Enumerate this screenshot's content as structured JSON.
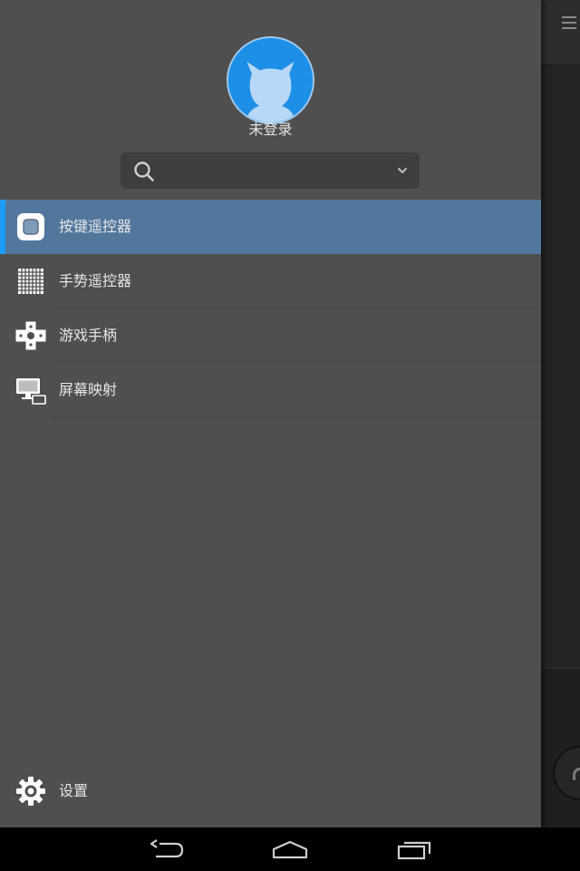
{
  "user": {
    "name": "未登录"
  },
  "search": {
    "value": "",
    "placeholder": ""
  },
  "menu": {
    "items": [
      {
        "label": "按键遥控器",
        "icon": "keypad-remote-icon",
        "active": true
      },
      {
        "label": "手势遥控器",
        "icon": "gesture-grid-icon",
        "active": false
      },
      {
        "label": "游戏手柄",
        "icon": "gamepad-icon",
        "active": false
      },
      {
        "label": "屏幕映射",
        "icon": "screen-mirror-icon",
        "active": false
      }
    ]
  },
  "settings": {
    "label": "设置",
    "icon": "gear-icon"
  },
  "colors": {
    "drawer_bg": "#4f4f4f",
    "active_bg": "#52779d",
    "active_accent": "#1e9bff",
    "avatar_blue": "#1e8fe6"
  },
  "navigation_bar": {
    "buttons": [
      "back-icon",
      "home-icon",
      "recents-icon"
    ]
  }
}
